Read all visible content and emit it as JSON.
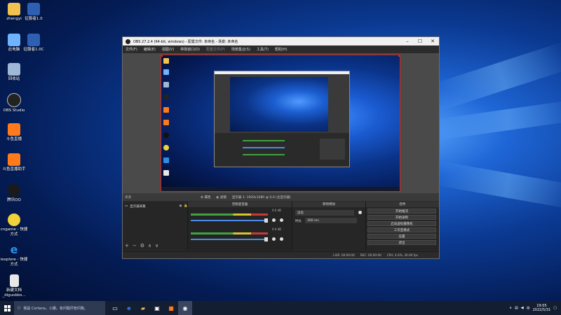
{
  "desktop": {
    "icons": [
      {
        "label": "zhengyi",
        "icon": "user-folder-icon",
        "color": "#f2c14e"
      },
      {
        "label": "征服者1.0",
        "icon": "app-icon",
        "color": "#2f5fb3"
      },
      {
        "label": "此电脑",
        "icon": "computer-icon",
        "color": "#6fb3ff"
      },
      {
        "label": "征服者1.0C",
        "icon": "app-icon",
        "color": "#2f5fb3"
      },
      {
        "label": "回收站",
        "icon": "recycle-bin-icon",
        "color": "#9fb8d6"
      },
      {
        "label": "OBS Studio",
        "icon": "obs-icon",
        "color": "#222222"
      },
      {
        "label": "斗鱼直播",
        "icon": "douyu-icon",
        "color": "#ff7a1a"
      },
      {
        "label": "斗鱼直播助手",
        "icon": "douyu-assistant-icon",
        "color": "#ff7a1a"
      },
      {
        "label": "腾讯QQ",
        "icon": "qq-icon",
        "color": "#1a1a1a"
      },
      {
        "label": "cngame - 快捷方式",
        "icon": "game-icon",
        "color": "#f0d23a"
      },
      {
        "label": "iexplore - 快捷方式",
        "icon": "ie-icon",
        "color": "#2b8fe8"
      },
      {
        "label": "新建文档_diguobbs...",
        "icon": "document-icon",
        "color": "#e8e8e8"
      }
    ]
  },
  "obs": {
    "title": "OBS 27.2.4 (64-bit, windows) - 配置文件: 未命名 - 场景: 未命名",
    "menu": [
      "文件(F)",
      "编辑(E)",
      "视图(V)",
      "停靠窗口(D)",
      "配置文件(P)",
      "场景集合(S)",
      "工具(T)",
      "帮助(H)"
    ],
    "source_bar": {
      "label": "来源",
      "tabs": [
        "属性",
        "滤镜",
        "显示器 1: 1920x1080 @ 0,0 (主显示器)"
      ]
    },
    "panels": {
      "scenes_header": "",
      "audio_header": "音频混音器",
      "transitions_header": "转场特效",
      "controls_header": "控件"
    },
    "source_item": "显示器采集",
    "audio": {
      "track1": {
        "db": "0.0 dB"
      },
      "track2": {
        "db": "0.0 dB"
      }
    },
    "transition": {
      "name": "淡化",
      "duration_label": "时长",
      "duration_value": "300 ms"
    },
    "controls": [
      "开始推流",
      "开始录制",
      "启动虚拟摄像机",
      "工作室模式",
      "设置",
      "退出"
    ],
    "status": {
      "live": "LIVE: 00:00:00",
      "rec": "REC: 00:00:00",
      "cpu": "CPU: 4.6%, 30.00 fps"
    }
  },
  "taskbar": {
    "search_placeholder": "在这里输入你要搜索的内容",
    "search_text": "我是 Cortana，小娜。有问题尽管问我。",
    "time": "19:05",
    "date": "2022/5/31"
  },
  "colors": {
    "accent_red": "#e02020",
    "obs_bg": "#2b2b2b",
    "taskbar_bg": "#141e33"
  }
}
